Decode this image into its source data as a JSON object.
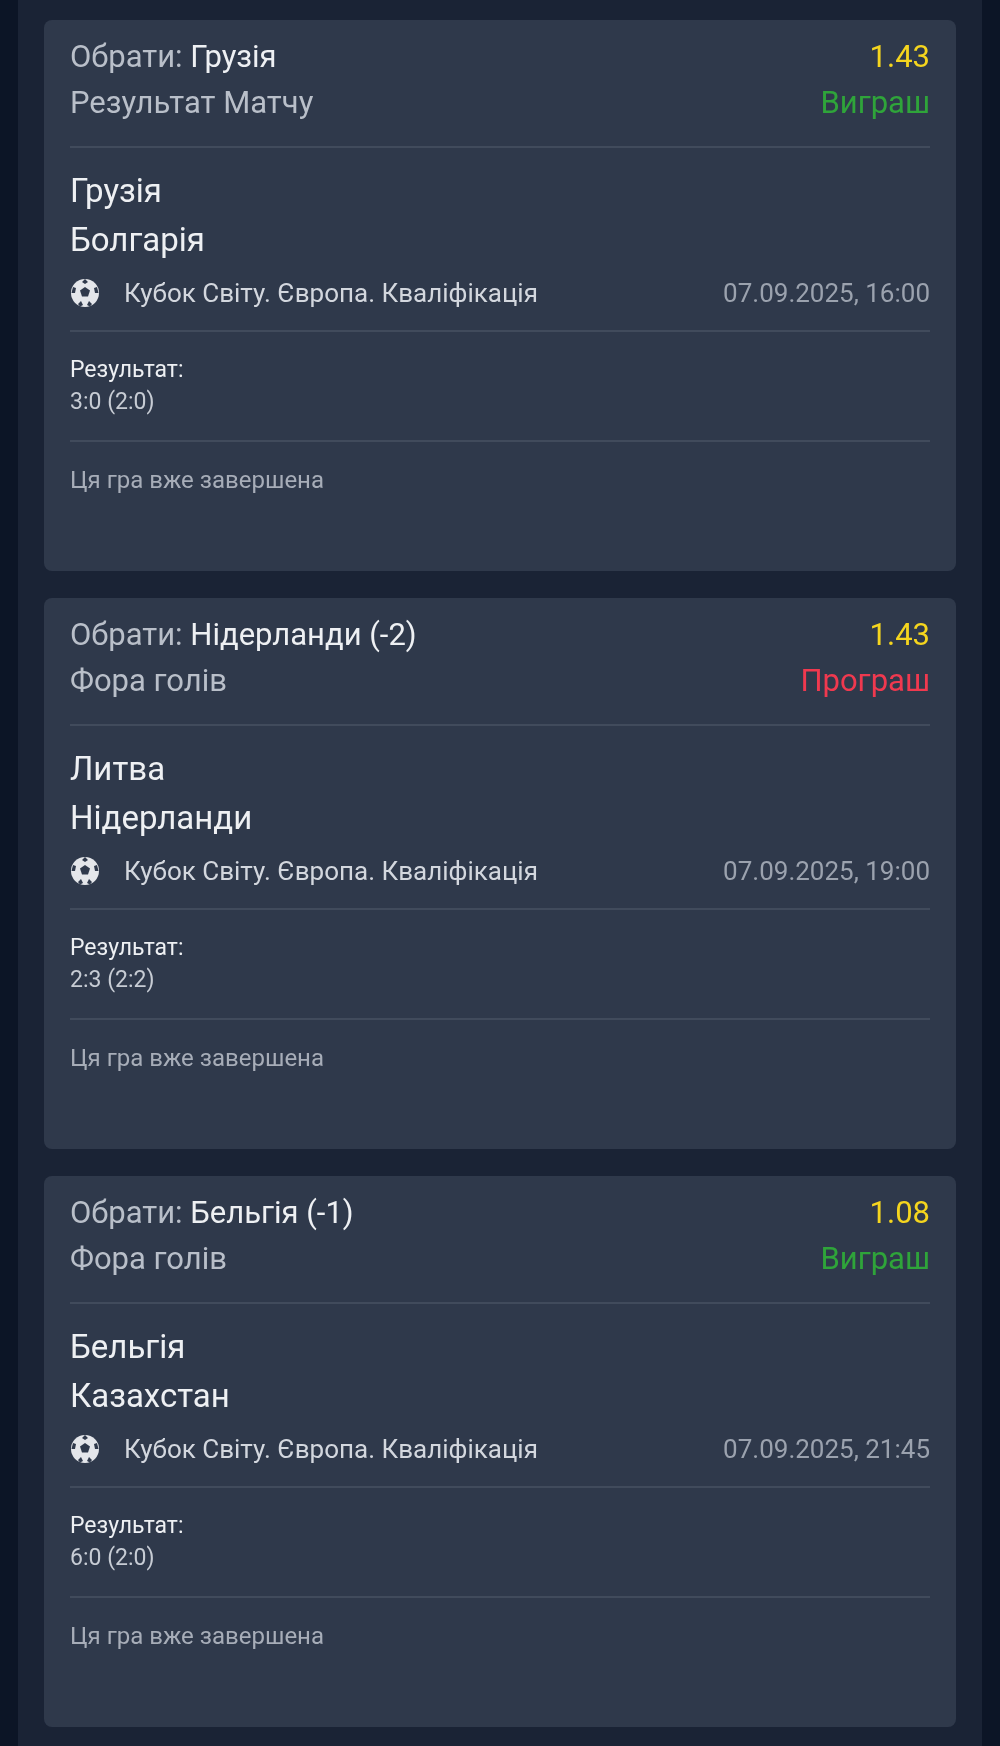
{
  "bets": [
    {
      "pick_label": "Обрати:",
      "pick": "Грузія",
      "market": "Результат Матчу",
      "odds": "1.43",
      "status": {
        "text": "Виграш",
        "kind": "win"
      },
      "teams": [
        "Грузія",
        "Болгарія"
      ],
      "tournament": "Кубок Світу. Європа. Кваліфікація",
      "datetime": "07.09.2025, 16:00",
      "result_label": "Результат:",
      "result": "3:0 (2:0)",
      "note": "Ця гра вже завершена"
    },
    {
      "pick_label": "Обрати:",
      "pick": "Нідерланди (-2)",
      "market": "Фора голів",
      "odds": "1.43",
      "status": {
        "text": "Програш",
        "kind": "loss"
      },
      "teams": [
        "Литва",
        "Нідерланди"
      ],
      "tournament": "Кубок Світу. Європа. Кваліфікація",
      "datetime": "07.09.2025, 19:00",
      "result_label": "Результат:",
      "result": "2:3 (2:2)",
      "note": "Ця гра вже завершена"
    },
    {
      "pick_label": "Обрати:",
      "pick": "Бельгія (-1)",
      "market": "Фора голів",
      "odds": "1.08",
      "status": {
        "text": "Виграш",
        "kind": "win"
      },
      "teams": [
        "Бельгія",
        "Казахстан"
      ],
      "tournament": "Кубок Світу. Європа. Кваліфікація",
      "datetime": "07.09.2025, 21:45",
      "result_label": "Результат:",
      "result": "6:0 (2:0)",
      "note": "Ця гра вже завершена"
    }
  ]
}
